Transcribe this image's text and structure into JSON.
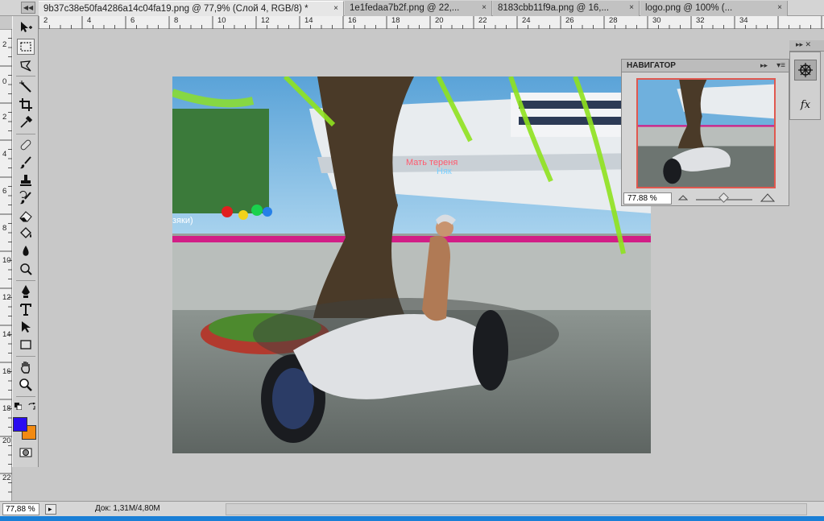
{
  "tabs": [
    {
      "label": "9b37c38e50fa4286a14c04fa19.png @ 77,9% (Слой 4, RGB/8) *",
      "active": true
    },
    {
      "label": "1e1fedaa7b2f.png @ 22,...",
      "active": false
    },
    {
      "label": "8183cbb11f9a.png @ 16,...",
      "active": false
    },
    {
      "label": "logo.png @ 100% (...",
      "active": false
    }
  ],
  "tab_scroll_glyph": "◀◀",
  "close_glyph": "×",
  "ruler": {
    "h_marks": [
      "2",
      "4",
      "6",
      "8",
      "10",
      "12",
      "14",
      "16",
      "18",
      "20",
      "22",
      "24",
      "26",
      "28",
      "30",
      "32",
      "34"
    ],
    "v_marks": [
      "2",
      "0",
      "2",
      "4",
      "6",
      "8",
      "10",
      "12",
      "14",
      "16",
      "18",
      "20",
      "22"
    ]
  },
  "tools": [
    {
      "name": "move-tool-icon"
    },
    {
      "name": "marquee-tool-icon",
      "active": true
    },
    {
      "name": "lasso-tool-icon"
    },
    {
      "name": "magic-wand-tool-icon"
    },
    {
      "name": "crop-tool-icon"
    },
    {
      "name": "eyedropper-tool-icon"
    },
    {
      "name": "healing-brush-tool-icon"
    },
    {
      "name": "brush-tool-icon"
    },
    {
      "name": "clone-stamp-tool-icon"
    },
    {
      "name": "history-brush-tool-icon"
    },
    {
      "name": "eraser-tool-icon"
    },
    {
      "name": "paint-bucket-tool-icon"
    },
    {
      "name": "blur-tool-icon"
    },
    {
      "name": "dodge-tool-icon"
    },
    {
      "name": "pen-tool-icon"
    },
    {
      "name": "type-tool-icon"
    },
    {
      "name": "path-selection-tool-icon"
    },
    {
      "name": "rectangle-tool-icon"
    },
    {
      "name": "hand-tool-icon"
    },
    {
      "name": "zoom-tool-icon"
    }
  ],
  "colors": {
    "foreground": "#2a0cf0",
    "background": "#f28a12",
    "navigator_frame": "#e0584f"
  },
  "image": {
    "nameplate_title": "Мать тереня",
    "nameplate_sub": "Няк",
    "side_text": "зяки)"
  },
  "navigator": {
    "title": "НАВИГАТОР",
    "arrows": "▸▸",
    "menu": "▾≡",
    "zoom": "77.88 %"
  },
  "status": {
    "zoom": "77,88 %",
    "doc_info": "Док: 1,31M/4,80M",
    "arrow": "▸"
  },
  "dock": {
    "top_glyph": "▸▸ ✕",
    "fx_label": "fx"
  }
}
